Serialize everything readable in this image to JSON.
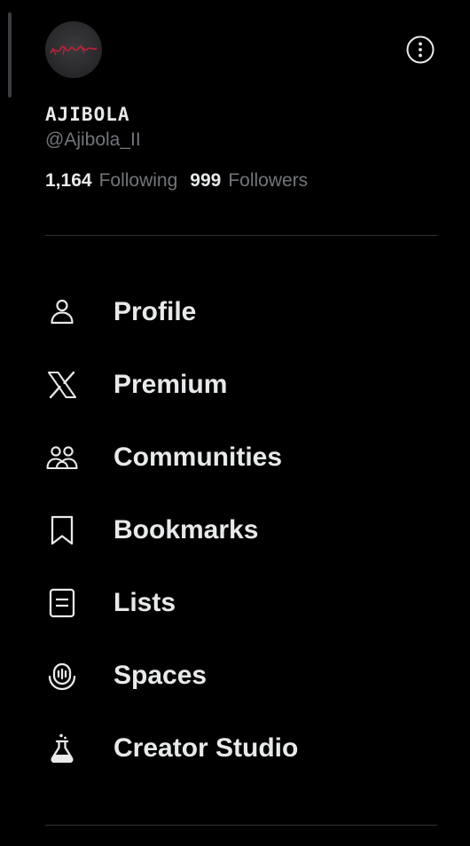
{
  "profile": {
    "avatar_text": "Nightmare",
    "display_name": "AJIBOLA",
    "handle": "@Ajibola_II",
    "following_count": "1,164",
    "following_label": "Following",
    "followers_count": "999",
    "followers_label": "Followers"
  },
  "menu": {
    "items": [
      {
        "label": "Profile",
        "icon": "person-icon"
      },
      {
        "label": "Premium",
        "icon": "x-logo-icon"
      },
      {
        "label": "Communities",
        "icon": "communities-icon"
      },
      {
        "label": "Bookmarks",
        "icon": "bookmark-icon"
      },
      {
        "label": "Lists",
        "icon": "list-icon"
      },
      {
        "label": "Spaces",
        "icon": "microphone-icon"
      },
      {
        "label": "Creator Studio",
        "icon": "flask-icon"
      }
    ]
  },
  "colors": {
    "background": "#000000",
    "primary_text": "#e7e9ea",
    "secondary_text": "#71767b",
    "divider": "#2f3336",
    "avatar_script": "#c2213a"
  }
}
